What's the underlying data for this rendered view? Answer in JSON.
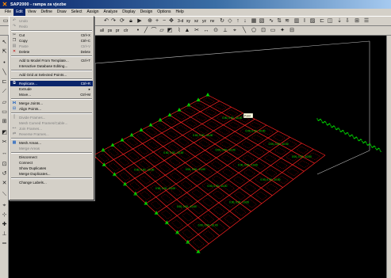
{
  "window": {
    "title": "SAP2000 - rampa za vjezbe",
    "app_icon": "sap2000-logo-icon"
  },
  "menubar": {
    "items": [
      "File",
      "Edit",
      "View",
      "Define",
      "Draw",
      "Select",
      "Assign",
      "Analyze",
      "Display",
      "Design",
      "Options",
      "Help"
    ],
    "active": "Edit"
  },
  "edit_menu": {
    "items": [
      {
        "label": "Undo",
        "shortcut": "",
        "disabled": true,
        "icon": "undo-icon"
      },
      {
        "label": "Redo",
        "shortcut": "",
        "disabled": true,
        "icon": "redo-icon"
      },
      {
        "sep": true
      },
      {
        "label": "Cut",
        "shortcut": "Ctrl+X",
        "disabled": false,
        "icon": "scissors-icon"
      },
      {
        "label": "Copy",
        "shortcut": "Ctrl+C",
        "disabled": false,
        "icon": "copy-icon"
      },
      {
        "label": "Paste",
        "shortcut": "Ctrl+V",
        "disabled": true,
        "icon": "paste-icon"
      },
      {
        "label": "Delete",
        "shortcut": "Delete",
        "disabled": false,
        "icon": "delete-x-icon"
      },
      {
        "sep": true
      },
      {
        "label": "Add to Model From Template...",
        "shortcut": "Ctrl+T",
        "disabled": false,
        "icon": ""
      },
      {
        "label": "Interactive Database Editing...",
        "shortcut": "",
        "disabled": false,
        "icon": ""
      },
      {
        "sep": true
      },
      {
        "label": "Add Grid at Selected Points...",
        "shortcut": "",
        "disabled": false,
        "icon": ""
      },
      {
        "sep": true
      },
      {
        "label": "Replicate...",
        "shortcut": "Ctrl+R",
        "disabled": false,
        "icon": "replicate-icon",
        "highlight": true
      },
      {
        "label": "Extrude",
        "shortcut": "",
        "disabled": false,
        "icon": "",
        "submenu": true
      },
      {
        "label": "Move...",
        "shortcut": "Ctrl+M",
        "disabled": false,
        "icon": ""
      },
      {
        "sep": true
      },
      {
        "label": "Merge Joints...",
        "shortcut": "",
        "disabled": false,
        "icon": "merge-joints-icon"
      },
      {
        "label": "Align Points...",
        "shortcut": "",
        "disabled": false,
        "icon": "align-points-icon"
      },
      {
        "sep": true
      },
      {
        "label": "Divide Frames...",
        "shortcut": "",
        "disabled": true,
        "icon": "divide-frames-icon"
      },
      {
        "label": "Mesh Curved Frames/Cable...",
        "shortcut": "",
        "disabled": true,
        "icon": ""
      },
      {
        "label": "Join Frames...",
        "shortcut": "",
        "disabled": true,
        "icon": "join-frames-icon"
      },
      {
        "label": "Reverse Frames...",
        "shortcut": "",
        "disabled": true,
        "icon": "reverse-frames-icon"
      },
      {
        "sep": true
      },
      {
        "label": "Mesh Areas...",
        "shortcut": "",
        "disabled": false,
        "icon": "mesh-areas-icon"
      },
      {
        "label": "Merge Areas",
        "shortcut": "",
        "disabled": true,
        "icon": ""
      },
      {
        "sep": true
      },
      {
        "label": "Disconnect",
        "shortcut": "",
        "disabled": false,
        "icon": ""
      },
      {
        "label": "Connect",
        "shortcut": "",
        "disabled": false,
        "icon": ""
      },
      {
        "label": "Show Duplicates",
        "shortcut": "",
        "disabled": false,
        "icon": ""
      },
      {
        "label": "Merge Duplicates...",
        "shortcut": "",
        "disabled": false,
        "icon": ""
      },
      {
        "sep": true
      },
      {
        "label": "Change Labels...",
        "shortcut": "",
        "disabled": false,
        "icon": ""
      }
    ]
  },
  "toolbar": {
    "view_3d": "3-d",
    "view_xy": "xy",
    "view_xz": "xz",
    "view_yz": "yz",
    "view_nv": "nv",
    "all_btn": "all",
    "ps_btn": "ps",
    "pr_btn": "pr",
    "clr_btn": "clr"
  },
  "viewport": {
    "tooltip": "Point",
    "area_label": "0.00, 0.00, -10.00",
    "colors": {
      "grid": "#ff2020",
      "area_edges": "#c00000",
      "area_labels": "#00ff00",
      "supports": "#00d000",
      "box": "#c0c0c0"
    }
  }
}
